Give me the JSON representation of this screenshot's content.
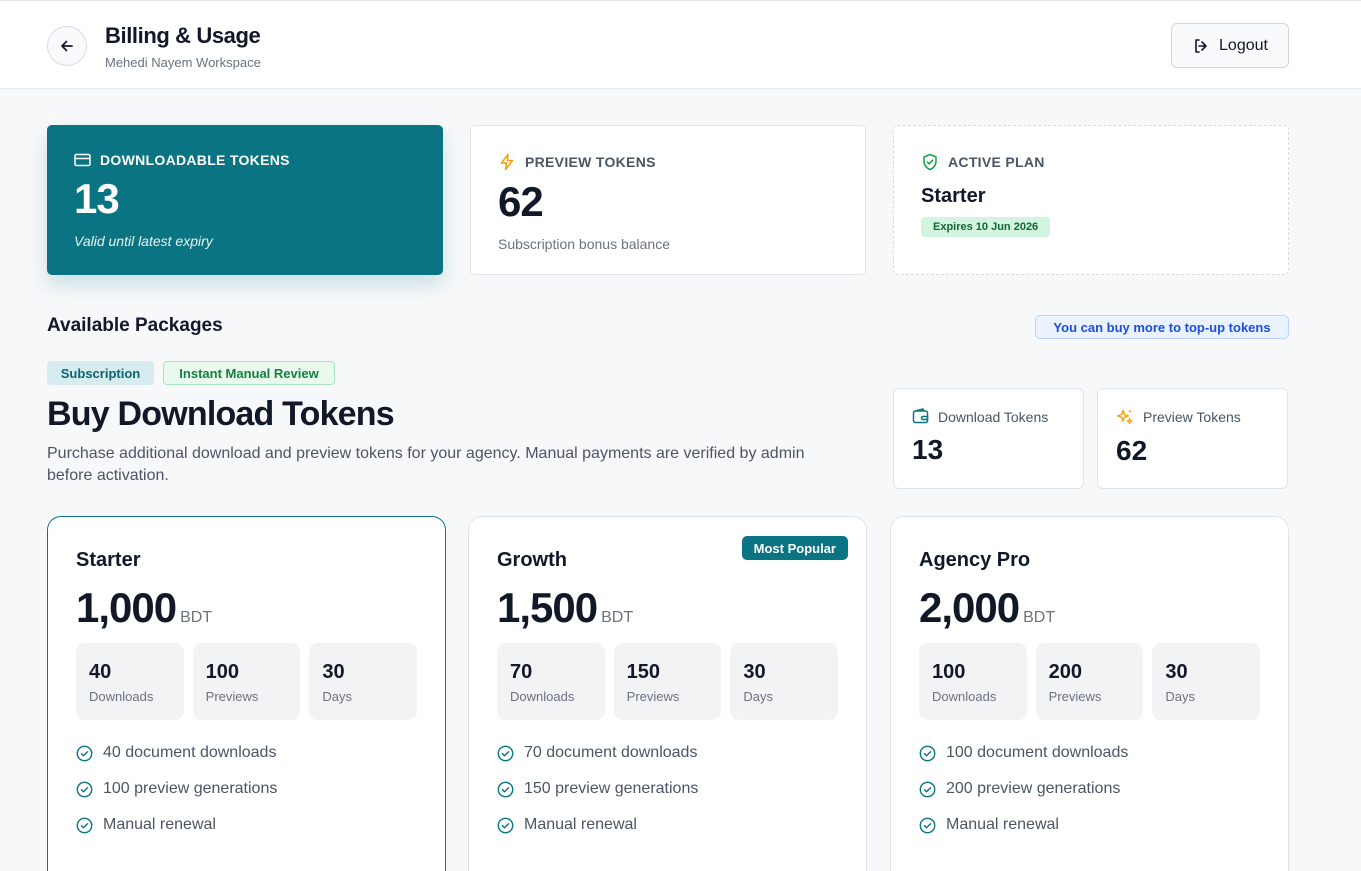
{
  "header": {
    "title": "Billing & Usage",
    "workspace": "Mehedi Nayem Workspace",
    "logout_label": "Logout"
  },
  "stats": [
    {
      "label": "DOWNLOADABLE TOKENS",
      "value": "13",
      "note": "Valid until latest expiry",
      "icon": "credit-card-icon"
    },
    {
      "label": "PREVIEW TOKENS",
      "value": "62",
      "note": "Subscription bonus balance",
      "icon": "lightning-icon"
    },
    {
      "label": "ACTIVE PLAN",
      "plan": "Starter",
      "expiry": "Expires 10 Jun 2026",
      "icon": "shield-check-icon"
    }
  ],
  "packages_section": {
    "title": "Available Packages",
    "topup_note": "You can buy more to top-up tokens",
    "tags": [
      "Subscription",
      "Instant Manual Review"
    ],
    "heading": "Buy Download Tokens",
    "description": "Purchase additional download and preview tokens for your agency. Manual payments are verified by admin before activation.",
    "balances": [
      {
        "label": "Download Tokens",
        "value": "13",
        "icon": "wallet-icon"
      },
      {
        "label": "Preview Tokens",
        "value": "62",
        "icon": "sparkles-icon"
      }
    ]
  },
  "packages": [
    {
      "name": "Starter",
      "price": "1,000",
      "currency": "BDT",
      "stats": [
        {
          "value": "40",
          "label": "Downloads"
        },
        {
          "value": "100",
          "label": "Previews"
        },
        {
          "value": "30",
          "label": "Days"
        }
      ],
      "features": [
        "40 document downloads",
        "100 preview generations",
        "Manual renewal"
      ]
    },
    {
      "name": "Growth",
      "price": "1,500",
      "currency": "BDT",
      "badge": "Most Popular",
      "stats": [
        {
          "value": "70",
          "label": "Downloads"
        },
        {
          "value": "150",
          "label": "Previews"
        },
        {
          "value": "30",
          "label": "Days"
        }
      ],
      "features": [
        "70 document downloads",
        "150 preview generations",
        "Manual renewal"
      ]
    },
    {
      "name": "Agency Pro",
      "price": "2,000",
      "currency": "BDT",
      "stats": [
        {
          "value": "100",
          "label": "Downloads"
        },
        {
          "value": "200",
          "label": "Previews"
        },
        {
          "value": "30",
          "label": "Days"
        }
      ],
      "features": [
        "100 document downloads",
        "200 preview generations",
        "Manual renewal"
      ]
    }
  ],
  "colors": {
    "teal": "#0b7482",
    "amber": "#f59e0b",
    "green": "#16a34a",
    "blue": "#1d4ed8"
  }
}
